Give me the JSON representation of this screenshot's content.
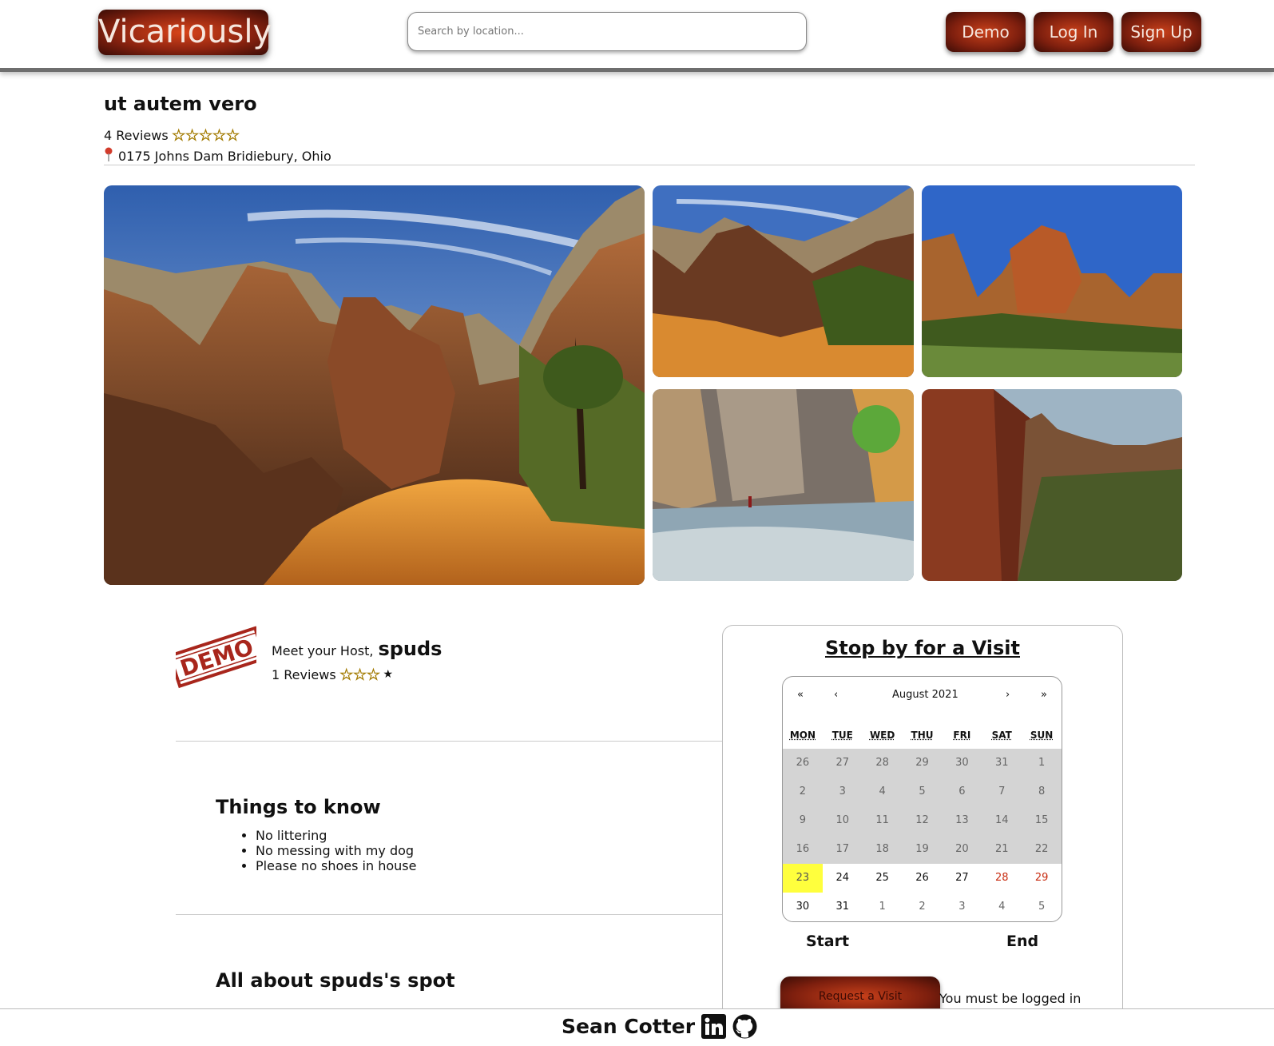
{
  "header": {
    "logo": "Vicariously",
    "search_placeholder": "Search by location...",
    "buttons": {
      "demo": "Demo",
      "login": "Log In",
      "signup": "Sign Up"
    },
    "accent": "#8e2410"
  },
  "listing": {
    "title": "ut autem vero",
    "reviews_label": "4 Reviews",
    "stars": "☆☆☆☆☆",
    "address": "0175 Johns Dam Bridiebury, Ohio"
  },
  "host": {
    "prefix": "Meet your Host,",
    "name": "spuds",
    "reviews_label": "1 Reviews",
    "stars_filled": "☆☆☆",
    "stars_empty": "★",
    "stamp_text": "DEMO"
  },
  "things_to_know": {
    "title": "Things to know",
    "items": [
      "No littering",
      "No messing with my dog",
      "Please no shoes in house"
    ]
  },
  "about": {
    "title": "All about spuds's spot",
    "text": ""
  },
  "booking": {
    "title": "Stop by for a Visit",
    "calendar": {
      "month_label": "August 2021",
      "nav": {
        "prev2": "«",
        "prev": "‹",
        "next": "›",
        "next2": "»"
      },
      "weekdays": [
        "MON",
        "TUE",
        "WED",
        "THU",
        "FRI",
        "SAT",
        "SUN"
      ],
      "weeks": [
        [
          "26",
          "27",
          "28",
          "29",
          "30",
          "31",
          "1"
        ],
        [
          "2",
          "3",
          "4",
          "5",
          "6",
          "7",
          "8"
        ],
        [
          "9",
          "10",
          "11",
          "12",
          "13",
          "14",
          "15"
        ],
        [
          "16",
          "17",
          "18",
          "19",
          "20",
          "21",
          "22"
        ],
        [
          "23",
          "24",
          "25",
          "26",
          "27",
          "28",
          "29"
        ],
        [
          "30",
          "31",
          "1",
          "2",
          "3",
          "4",
          "5"
        ]
      ],
      "today": "23"
    },
    "start_label": "Start",
    "end_label": "End",
    "request_button": "Request a Visit",
    "login_note": "You must be logged in"
  },
  "footer": {
    "name": "Sean Cotter"
  }
}
